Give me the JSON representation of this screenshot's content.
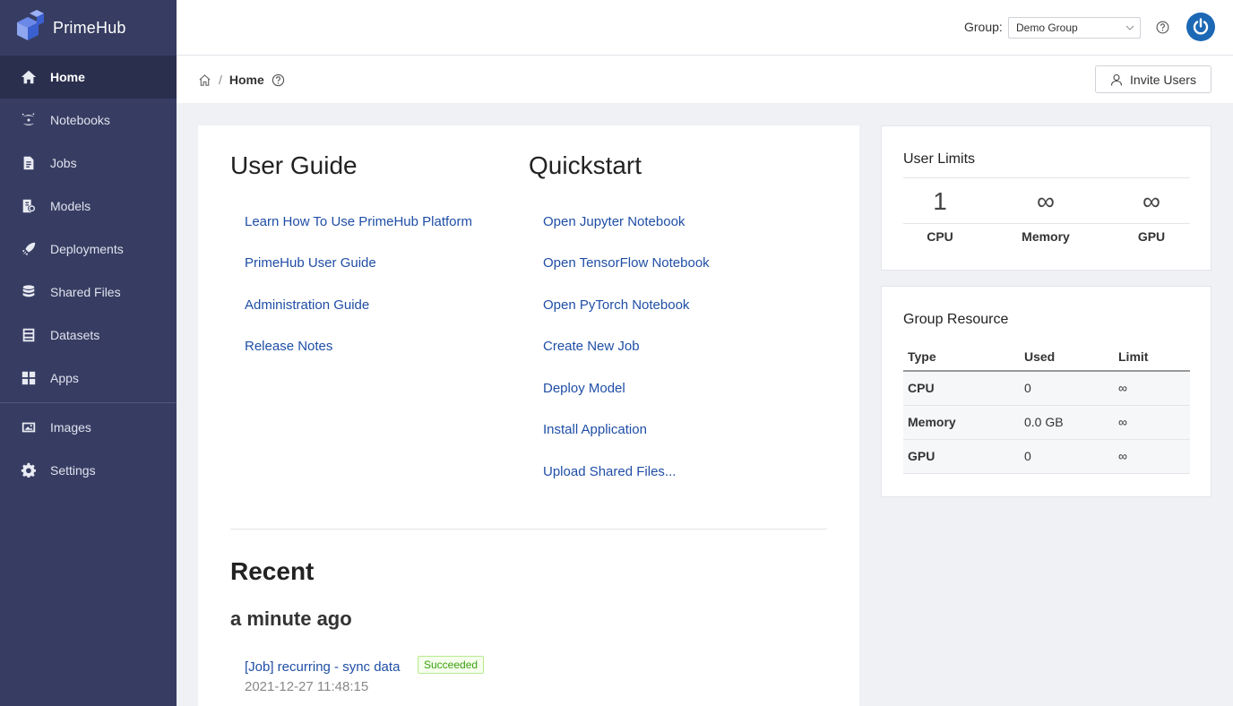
{
  "brand": {
    "name": "PrimeHub"
  },
  "sidebar": {
    "items": [
      {
        "label": "Home",
        "icon": "home-icon",
        "active": true
      },
      {
        "label": "Notebooks",
        "icon": "jupyter-icon"
      },
      {
        "label": "Jobs",
        "icon": "jobs-icon"
      },
      {
        "label": "Models",
        "icon": "models-icon"
      },
      {
        "label": "Deployments",
        "icon": "rocket-icon"
      },
      {
        "label": "Shared Files",
        "icon": "database-icon"
      },
      {
        "label": "Datasets",
        "icon": "datasets-icon"
      },
      {
        "label": "Apps",
        "icon": "apps-grid-icon"
      },
      {
        "label": "Images",
        "icon": "image-icon"
      },
      {
        "label": "Settings",
        "icon": "gear-icon"
      }
    ]
  },
  "header": {
    "group_label": "Group:",
    "group_value": "Demo Group"
  },
  "breadcrumb": {
    "sep": "/",
    "current": "Home"
  },
  "toolbar": {
    "invite_label": "Invite Users"
  },
  "user_guide": {
    "title": "User Guide",
    "links": [
      "Learn How To Use PrimeHub Platform",
      "PrimeHub User Guide",
      "Administration Guide",
      "Release Notes"
    ]
  },
  "quickstart": {
    "title": "Quickstart",
    "links": [
      "Open Jupyter Notebook",
      "Open TensorFlow Notebook",
      "Open PyTorch Notebook",
      "Create New Job",
      "Deploy Model",
      "Install Application",
      "Upload Shared Files..."
    ]
  },
  "recent": {
    "title": "Recent",
    "group": "a minute ago",
    "item": {
      "label": "[Job] recurring - sync data",
      "status": "Succeeded",
      "time": "2021-12-27 11:48:15"
    }
  },
  "user_limits": {
    "title": "User Limits",
    "cols": [
      {
        "value": "1",
        "label": "CPU"
      },
      {
        "value": "∞",
        "label": "Memory"
      },
      {
        "value": "∞",
        "label": "GPU"
      }
    ]
  },
  "group_resource": {
    "title": "Group Resource",
    "headers": [
      "Type",
      "Used",
      "Limit"
    ],
    "rows": [
      [
        "CPU",
        "0",
        "∞"
      ],
      [
        "Memory",
        "0.0 GB",
        "∞"
      ],
      [
        "GPU",
        "0",
        "∞"
      ]
    ]
  },
  "colors": {
    "sidebar": "#373d62",
    "sidebar_active": "#2a2f4e",
    "link": "#1f4ea6",
    "success": "#389e0d",
    "avatar": "#1c68b5"
  }
}
